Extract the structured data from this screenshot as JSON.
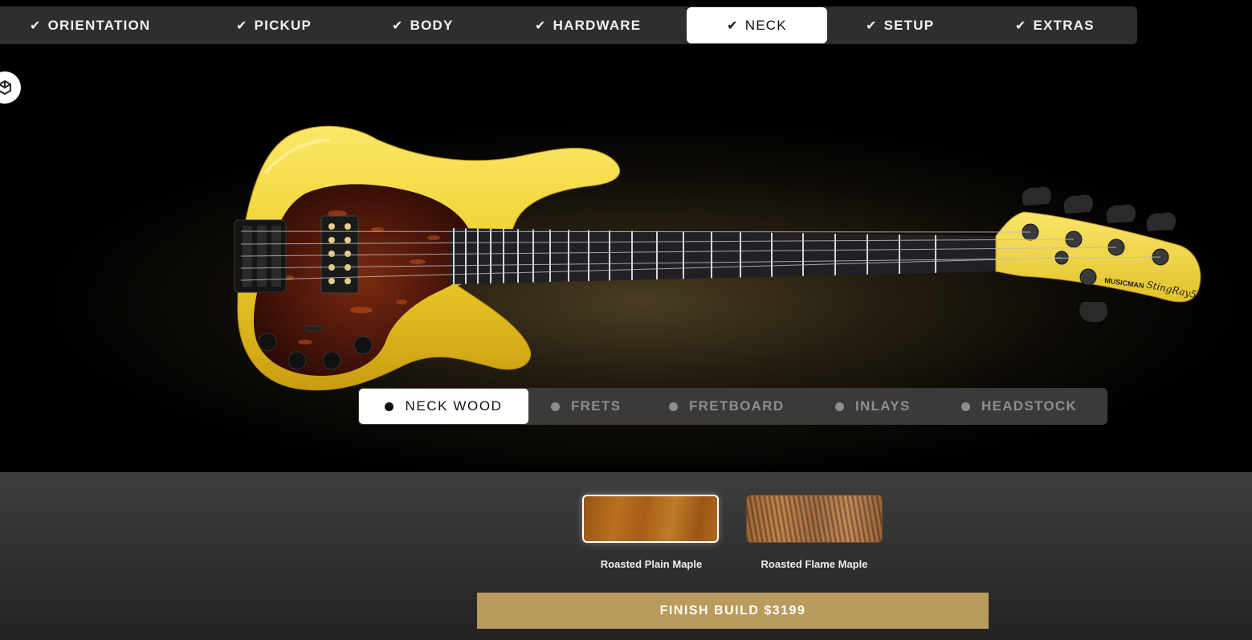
{
  "steps": [
    {
      "label": "ORIENTATION",
      "active": false
    },
    {
      "label": "PICKUP",
      "active": false
    },
    {
      "label": "BODY",
      "active": false
    },
    {
      "label": "HARDWARE",
      "active": false
    },
    {
      "label": "NECK",
      "active": true
    },
    {
      "label": "SETUP",
      "active": false
    },
    {
      "label": "EXTRAS",
      "active": false
    }
  ],
  "check_glyph": "✔",
  "subtabs": [
    {
      "label": "NECK WOOD",
      "active": true
    },
    {
      "label": "FRETS",
      "active": false
    },
    {
      "label": "FRETBOARD",
      "active": false
    },
    {
      "label": "INLAYS",
      "active": false
    },
    {
      "label": "HEADSTOCK",
      "active": false
    }
  ],
  "headstock_logo": "MUSICMAN",
  "headstock_model": "StingRay5",
  "swatches": [
    {
      "label": "Roasted Plain Maple",
      "selected": true
    },
    {
      "label": "Roasted Flame Maple",
      "selected": false
    }
  ],
  "finish_button": "FINISH BUILD $3199",
  "colors": {
    "accent": "#b99b5d",
    "body": "#f0d232",
    "pickguard": "#5a1a0c"
  }
}
